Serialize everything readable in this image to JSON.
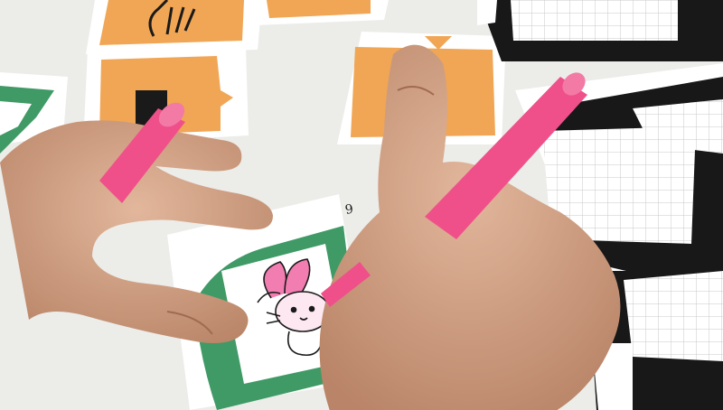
{
  "scene": {
    "description_colors": {
      "table": "#ecece9",
      "orange_card": "#f0a654",
      "green_card": "#3f9a66",
      "black_frame": "#181818",
      "marker_pink": "#f0508a",
      "skin": "#d6a78a"
    },
    "card_number": "9"
  }
}
